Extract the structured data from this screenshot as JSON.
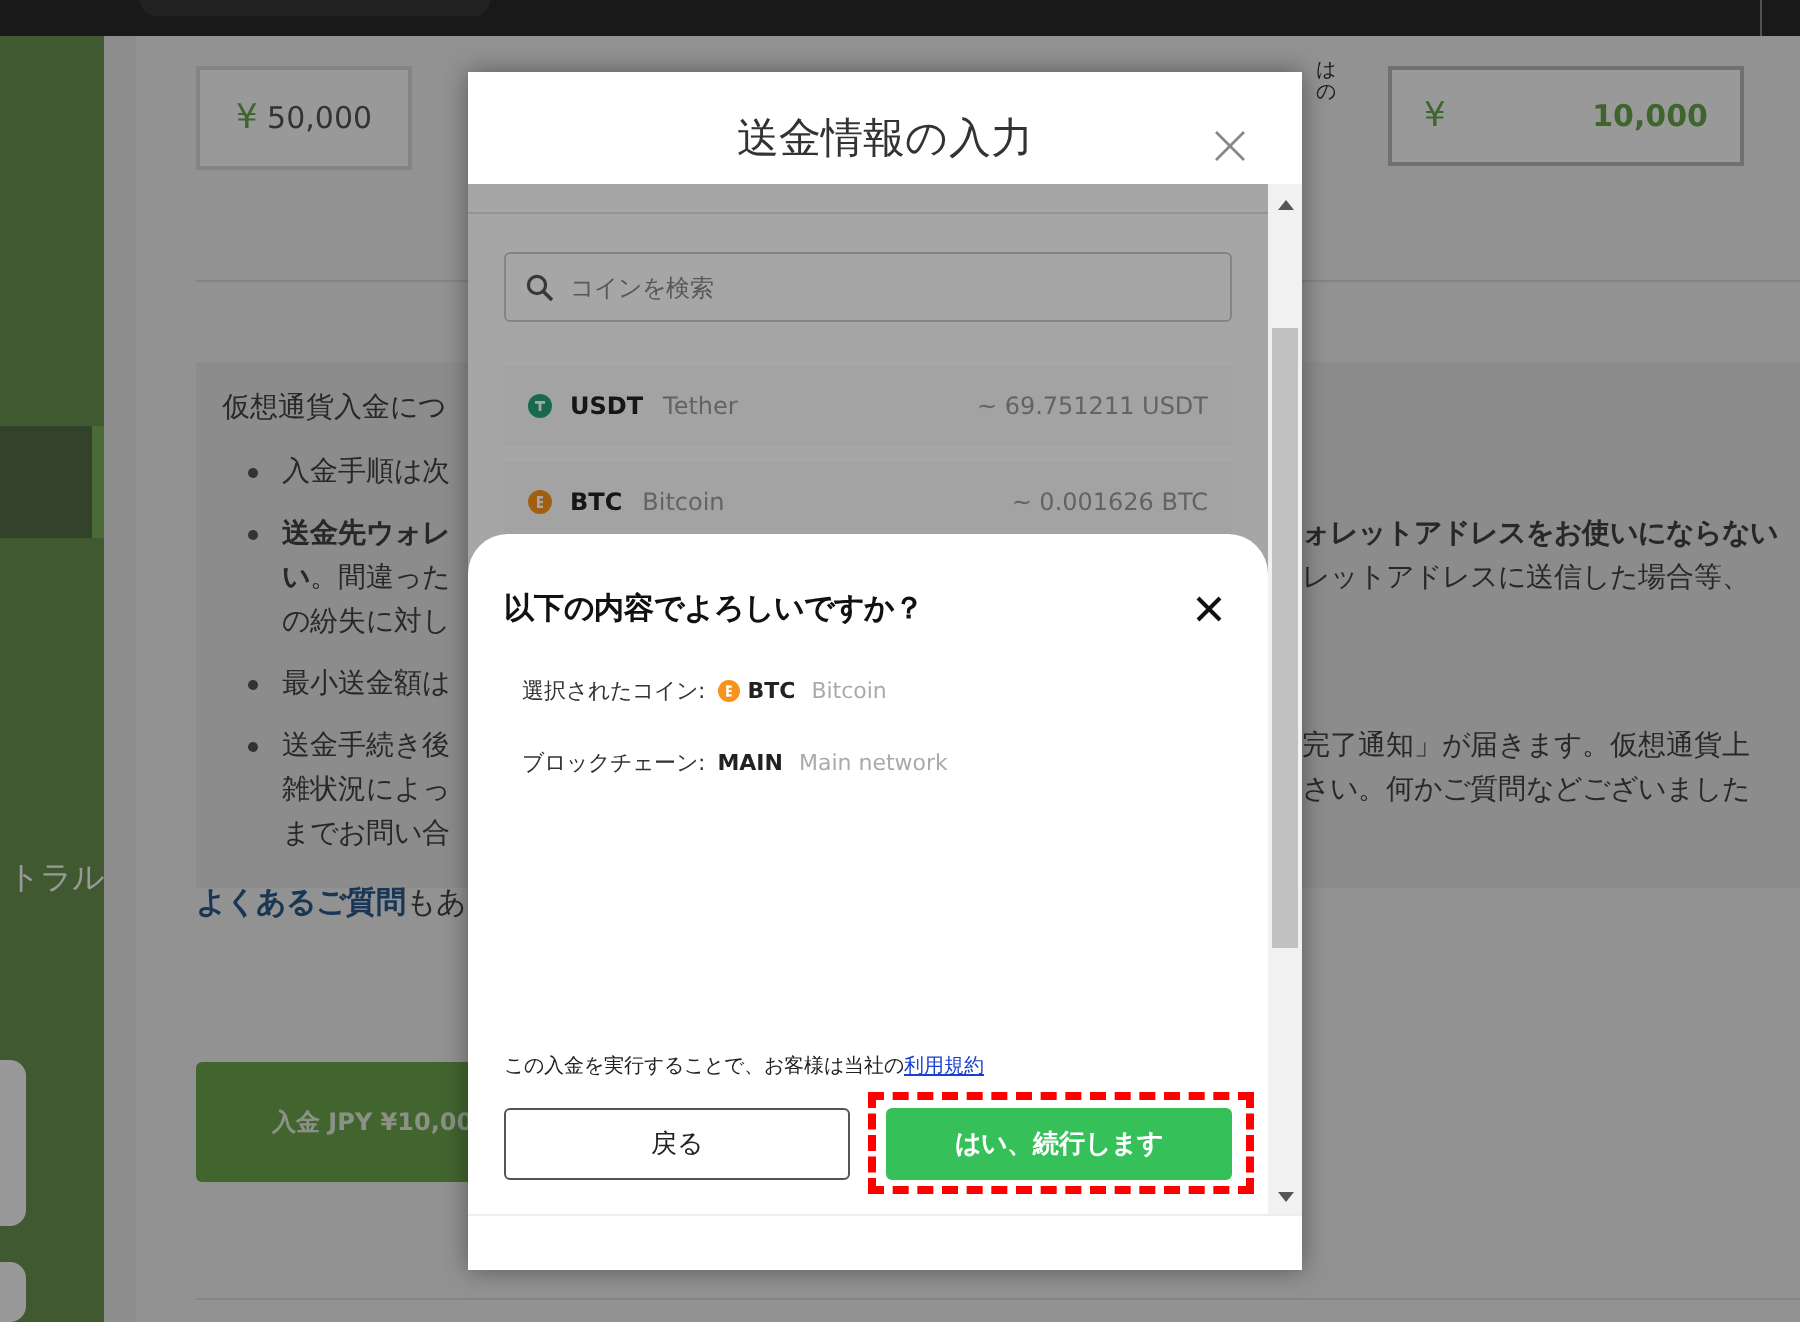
{
  "sidebar": {
    "items": [
      {
        "selected": true
      },
      {
        "label": "トラル",
        "selected": false
      }
    ]
  },
  "amount_options": [
    {
      "currency": "¥",
      "amount": "50,000"
    }
  ],
  "custom_amount": {
    "label_lines": [
      "は",
      "の"
    ],
    "currency": "¥",
    "value": "10,000"
  },
  "info": {
    "title": "仮想通貨入金につ",
    "bullets": [
      {
        "lines": [
          {
            "left": "入金手順は次"
          }
        ]
      },
      {
        "lines": [
          {
            "left": "**送金先ウォレ**",
            "right": "**ォレットアドレスをお使いにならない**"
          },
          {
            "left": "**い**。間違った",
            "right": "レットアドレスに送信した場合等、"
          },
          {
            "left": "の紛失に対し"
          }
        ]
      },
      {
        "lines": [
          {
            "left": "最小送金額は"
          }
        ]
      },
      {
        "lines": [
          {
            "left": "送金手続き後",
            "right": "完了通知」が届きます。仮想通貨上"
          },
          {
            "left": "雑状況によっ",
            "right": "さい。何かご質問などございました"
          },
          {
            "left": "までお問い合"
          }
        ]
      }
    ]
  },
  "faq": {
    "link": "よくあるご質問",
    "text": "もあ"
  },
  "deposit_button": "入金 JPY ¥10,00",
  "modal": {
    "title": "送金情報の入力",
    "search": {
      "placeholder": "コインを検索"
    },
    "coins": [
      {
        "kind": "usdt",
        "symbol": "USDT",
        "name": "Tether",
        "estimate": "~ 69.751211 USDT"
      },
      {
        "kind": "btc",
        "symbol": "BTC",
        "name": "Bitcoin",
        "estimate": "~ 0.001626 BTC"
      }
    ],
    "confirm": {
      "title": "以下の内容でよろしいですか？",
      "rows": [
        {
          "label": "選択されたコイン:",
          "kind": "btc",
          "value": "BTC",
          "detail": "Bitcoin"
        },
        {
          "label": "ブロックチェーン:",
          "value": "MAIN",
          "detail": "Main network"
        }
      ],
      "consent": "この入金を実行することで、お客様は当社の",
      "terms_link": "利用規約",
      "buttons": [
        {
          "kind": "secondary",
          "label": "戻る",
          "highlighted": false
        },
        {
          "kind": "primary",
          "label": "はい、続行します",
          "highlighted": true
        }
      ]
    }
  }
}
